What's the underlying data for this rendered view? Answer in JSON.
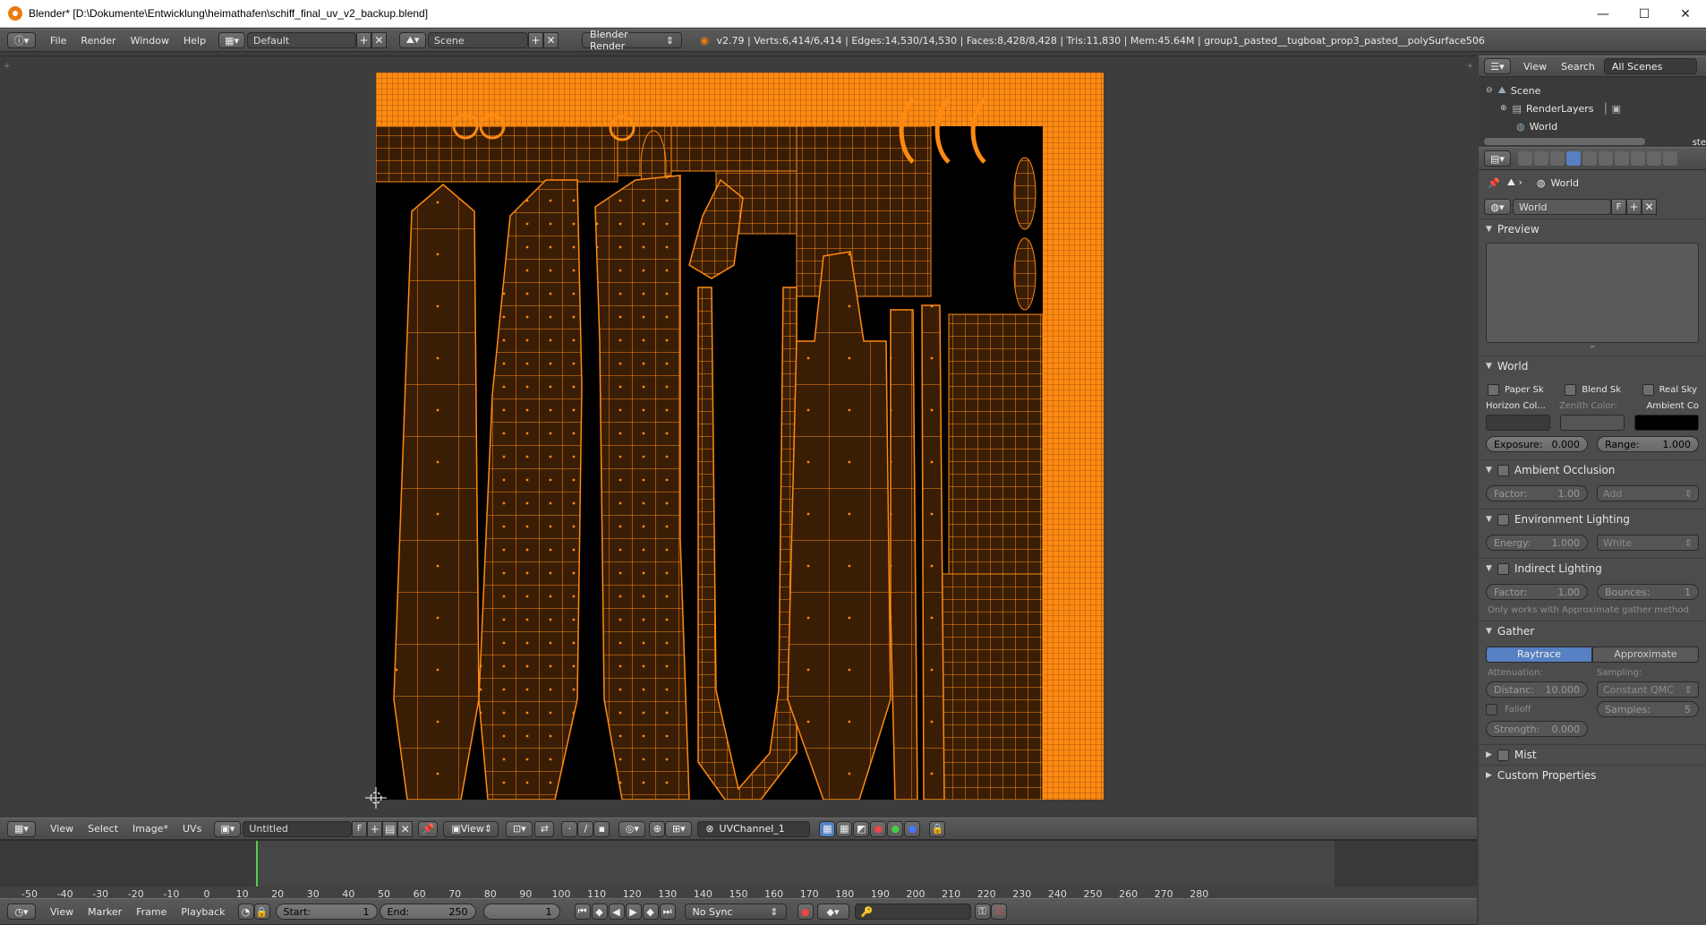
{
  "window": {
    "title": "Blender* [D:\\Dokumente\\Entwicklung\\heimathafen\\schiff_final_uv_v2_backup.blend]",
    "minimize": "—",
    "maximize": "☐",
    "close": "✕"
  },
  "info_header": {
    "menus": [
      "File",
      "Render",
      "Window",
      "Help"
    ],
    "layout": "Default",
    "scene": "Scene",
    "engine": "Blender Render",
    "stats": "v2.79 | Verts:6,414/6,414 | Edges:14,530/14,530 | Faces:8,428/8,428 | Tris:11,830 | Mem:45.64M | group1_pasted__tugboat_prop3_pasted__polySurface506"
  },
  "outliner": {
    "menus": [
      "View",
      "Search"
    ],
    "display_mode": "All Scenes",
    "items": [
      "Scene",
      "RenderLayers",
      "World"
    ],
    "overflow_text": "ste"
  },
  "properties": {
    "breadcrumb": "World",
    "world_name": "World",
    "fake_user": "F",
    "preview_label": "Preview",
    "world_panel": {
      "label": "World",
      "checks": [
        "Paper Sk",
        "Blend Sk",
        "Real Sky"
      ],
      "colors": [
        {
          "label": "Horizon Col...",
          "value": "#4d4d4d"
        },
        {
          "label": "Zenith Color:",
          "value": "#4d4d4d"
        },
        {
          "label": "Ambient Co",
          "value": "#000000"
        }
      ],
      "exposure_label": "Exposure:",
      "exposure": "0.000",
      "range_label": "Range:",
      "range": "1.000"
    },
    "ao": {
      "label": "Ambient Occlusion",
      "factor_label": "Factor:",
      "factor": "1.00",
      "blend": "Add"
    },
    "env": {
      "label": "Environment Lighting",
      "energy_label": "Energy:",
      "energy": "1.000",
      "color": "White"
    },
    "indirect": {
      "label": "Indirect Lighting",
      "factor_label": "Factor:",
      "factor": "1.00",
      "bounces_label": "Bounces:",
      "bounces": "1",
      "note": "Only works with Approximate gather method"
    },
    "gather": {
      "label": "Gather",
      "methods": [
        "Raytrace",
        "Approximate"
      ],
      "attenuation_label": "Attenuation:",
      "sampling_label": "Sampling:",
      "distance_label": "Distanc:",
      "distance": "10.000",
      "sampling": "Constant QMC",
      "falloff_label": "Falloff",
      "samples_label": "Samples:",
      "samples": "5",
      "strength_label": "Strength:",
      "strength": "0.000"
    },
    "mist_label": "Mist",
    "custom_props_label": "Custom Properties"
  },
  "uv_header": {
    "menus": [
      "View",
      "Select",
      "Image*",
      "UVs"
    ],
    "image_name": "Untitled",
    "fake_user": "F",
    "view_mode": "View",
    "uv_map": "UVChannel_1"
  },
  "timeline": {
    "ticks": [
      "-50",
      "-40",
      "-30",
      "-20",
      "-10",
      "0",
      "10",
      "20",
      "30",
      "40",
      "50",
      "60",
      "70",
      "80",
      "90",
      "100",
      "110",
      "120",
      "130",
      "140",
      "150",
      "160",
      "170",
      "180",
      "190",
      "200",
      "210",
      "220",
      "230",
      "240",
      "250",
      "260",
      "270",
      "280"
    ],
    "menus": [
      "View",
      "Marker",
      "Frame",
      "Playback"
    ],
    "start_label": "Start:",
    "start": "1",
    "end_label": "End:",
    "end": "250",
    "current": "1",
    "sync": "No Sync"
  },
  "colors": {
    "uv_wire": "#ff8a12",
    "uv_face": "#3a1d05",
    "accent_blue": "#5680c2"
  }
}
